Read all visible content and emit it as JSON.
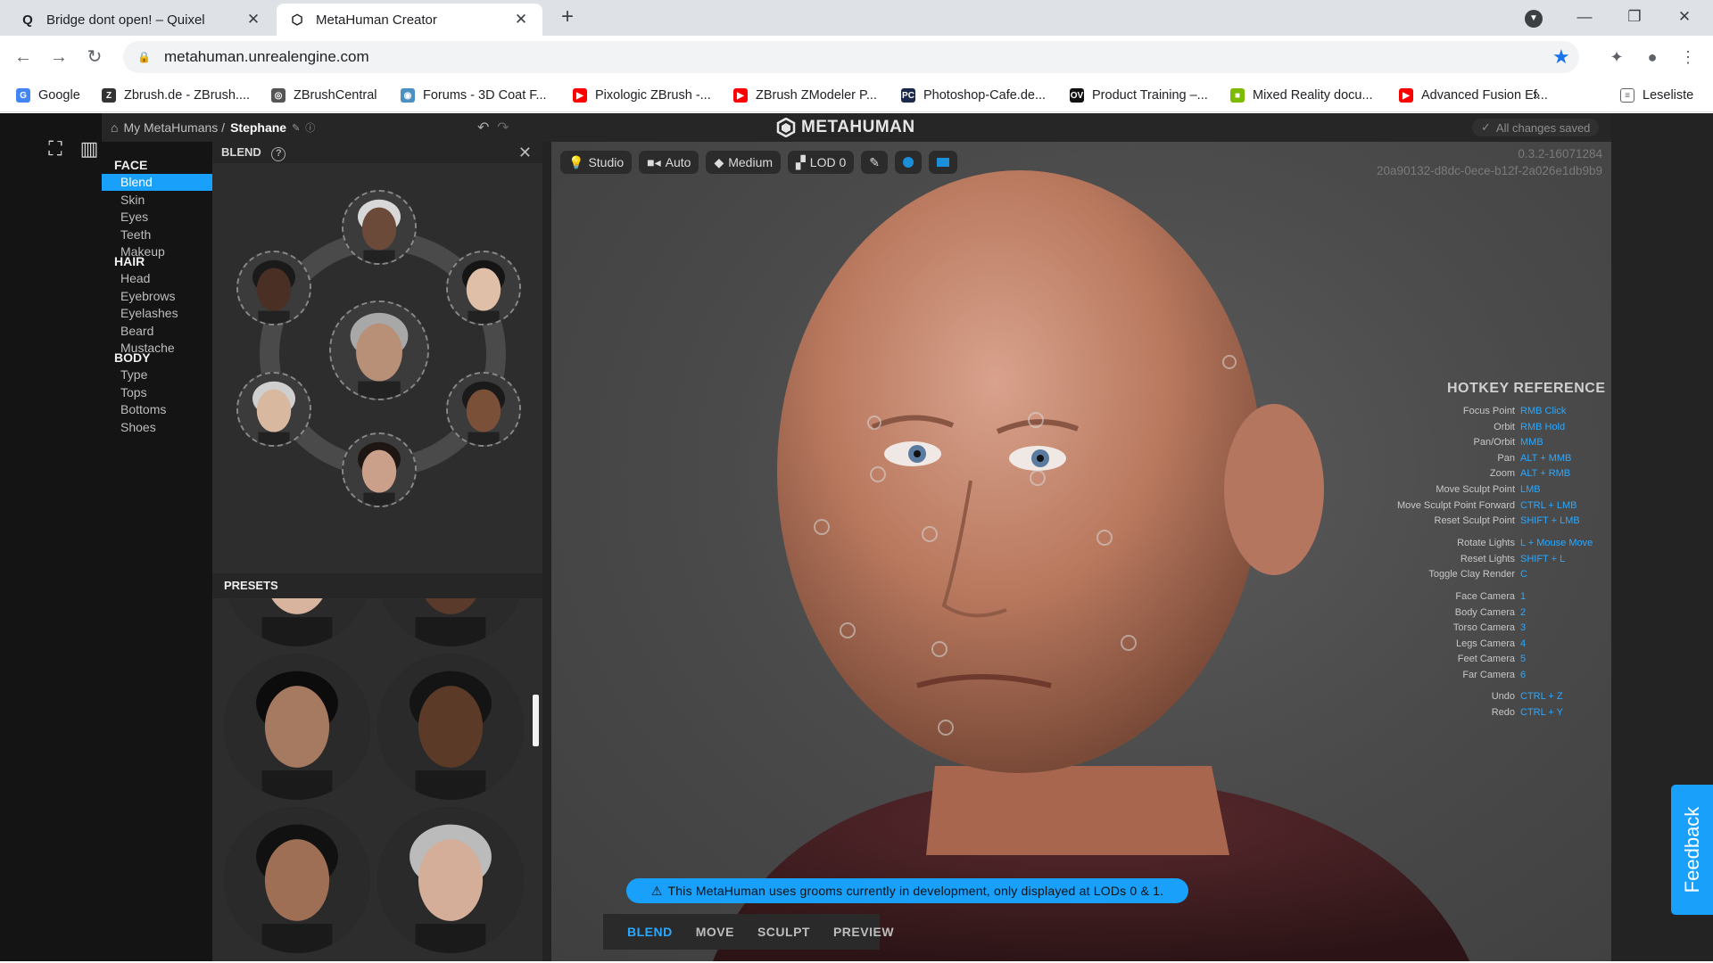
{
  "browser": {
    "tabs": [
      {
        "title": "Bridge dont open! – Quixel",
        "icon": "quixel-icon"
      },
      {
        "title": "MetaHuman Creator",
        "icon": "metahuman-icon"
      }
    ],
    "url": "metahuman.unrealengine.com",
    "bookmarks": [
      {
        "label": "Google",
        "color": "#4285f4",
        "glyph": "G"
      },
      {
        "label": "Zbrush.de - ZBrush....",
        "color": "#333333",
        "glyph": "Z"
      },
      {
        "label": "ZBrushCentral",
        "color": "#555555",
        "glyph": "◎"
      },
      {
        "label": "Forums - 3D Coat F...",
        "color": "#4a90c2",
        "glyph": "◉"
      },
      {
        "label": "Pixologic ZBrush -...",
        "color": "#ff0000",
        "glyph": "▶"
      },
      {
        "label": "ZBrush ZModeler P...",
        "color": "#ff0000",
        "glyph": "▶"
      },
      {
        "label": "Photoshop-Cafe.de...",
        "color": "#1b2a4a",
        "glyph": "PC"
      },
      {
        "label": "Product Training –...",
        "color": "#111111",
        "glyph": "OV"
      },
      {
        "label": "Mixed Reality docu...",
        "color": "#7cbb00",
        "glyph": "■"
      },
      {
        "label": "Advanced Fusion Ef...",
        "color": "#ff0000",
        "glyph": "▶"
      }
    ],
    "reading_list": "Leseliste",
    "more": "»"
  },
  "app": {
    "breadcrumb_root": "My MetaHumans /",
    "breadcrumb_current": "Stephane",
    "logo": "METAHUMAN",
    "saved_status": "All changes saved",
    "version_line1": "0.3.2-16071284",
    "version_line2": "20a90132-d8dc-0ece-b12f-2a026e1db9b9",
    "nav": {
      "face_header": "FACE",
      "face_items": [
        "Blend",
        "Skin",
        "Eyes",
        "Teeth",
        "Makeup"
      ],
      "hair_header": "HAIR",
      "hair_items": [
        "Head",
        "Eyebrows",
        "Eyelashes",
        "Beard",
        "Mustache"
      ],
      "body_header": "BODY",
      "body_items": [
        "Type",
        "Tops",
        "Bottoms",
        "Shoes"
      ]
    },
    "blend_title": "BLEND",
    "presets_title": "PRESETS",
    "viewport_tools": [
      "Studio",
      "Auto",
      "Medium",
      "LOD 0"
    ],
    "hotkey_title": "HOTKEY REFERENCE",
    "hotkeys": [
      {
        "action": "Focus Point",
        "key": "RMB Click"
      },
      {
        "action": "Orbit",
        "key": "RMB Hold"
      },
      {
        "action": "Pan/Orbit",
        "key": "MMB"
      },
      {
        "action": "Pan",
        "key": "ALT + MMB"
      },
      {
        "action": "Zoom",
        "key": "ALT + RMB"
      },
      {
        "action": "Move Sculpt Point",
        "key": "LMB"
      },
      {
        "action": "Move Sculpt Point Forward",
        "key": "CTRL + LMB"
      },
      {
        "action": "Reset Sculpt Point",
        "key": "SHIFT + LMB"
      },
      {
        "action": "Rotate Lights",
        "key": "L + Mouse Move"
      },
      {
        "action": "Reset Lights",
        "key": "SHIFT + L"
      },
      {
        "action": "Toggle Clay Render",
        "key": "C"
      },
      {
        "action": "Face Camera",
        "key": "1"
      },
      {
        "action": "Body Camera",
        "key": "2"
      },
      {
        "action": "Torso Camera",
        "key": "3"
      },
      {
        "action": "Legs Camera",
        "key": "4"
      },
      {
        "action": "Feet Camera",
        "key": "5"
      },
      {
        "action": "Far Camera",
        "key": "6"
      },
      {
        "action": "Undo",
        "key": "CTRL + Z"
      },
      {
        "action": "Redo",
        "key": "CTRL + Y"
      }
    ],
    "warning": "This MetaHuman uses grooms currently in development, only displayed at LODs 0 & 1.",
    "modes": [
      "BLEND",
      "MOVE",
      "SCULPT",
      "PREVIEW"
    ],
    "feedback": "Feedback"
  }
}
